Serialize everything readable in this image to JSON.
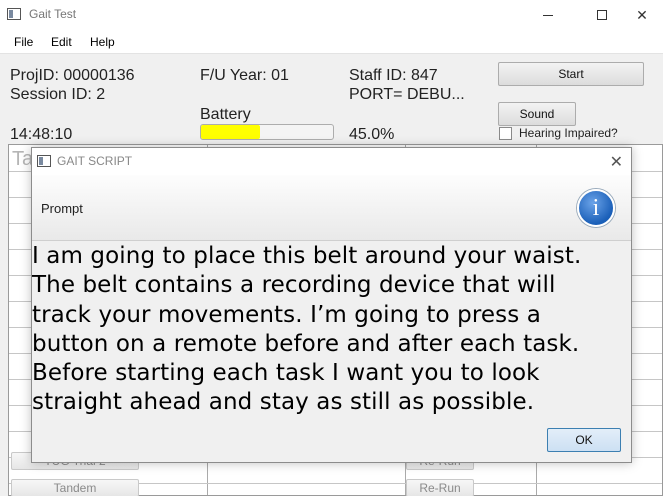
{
  "window": {
    "title": "Gait Test",
    "min_symbol": "",
    "max_symbol": "",
    "close_symbol": "✕"
  },
  "menu": [
    "File",
    "Edit",
    "Help"
  ],
  "info": {
    "proj_id": "ProjID: 00000136",
    "session_id": "Session ID: 2",
    "fu_year": "F/U Year: 01",
    "staff_id": "Staff ID: 847",
    "port": "PORT= DEBU...",
    "time": "14:48:10",
    "battery_label": "Battery",
    "battery_percent_text": "45.0%",
    "battery_level": 0.45,
    "battery_color": "#ffff00"
  },
  "controls": {
    "start_label": "Start",
    "sound_label": "Sound",
    "hearing_label": "Hearing Impaired?"
  },
  "table": {
    "header_fragment": "Ta",
    "rows": [
      {
        "task": "TUG Trial 2",
        "action": "Re-Run"
      },
      {
        "task": "Tandem",
        "action": "Re-Run"
      }
    ]
  },
  "dialog": {
    "title": "GAIT SCRIPT",
    "close_symbol": "✕",
    "prompt_label": "Prompt",
    "info_glyph": "i",
    "message_lines": [
      "I am going to place this belt around your waist.",
      "The belt contains a recording device that will",
      "track your movements. I’m going to press a",
      "button on a remote before and after each task.",
      "Before starting each task I want you to look",
      "straight ahead and stay as still as possible."
    ],
    "ok_label": "OK"
  }
}
